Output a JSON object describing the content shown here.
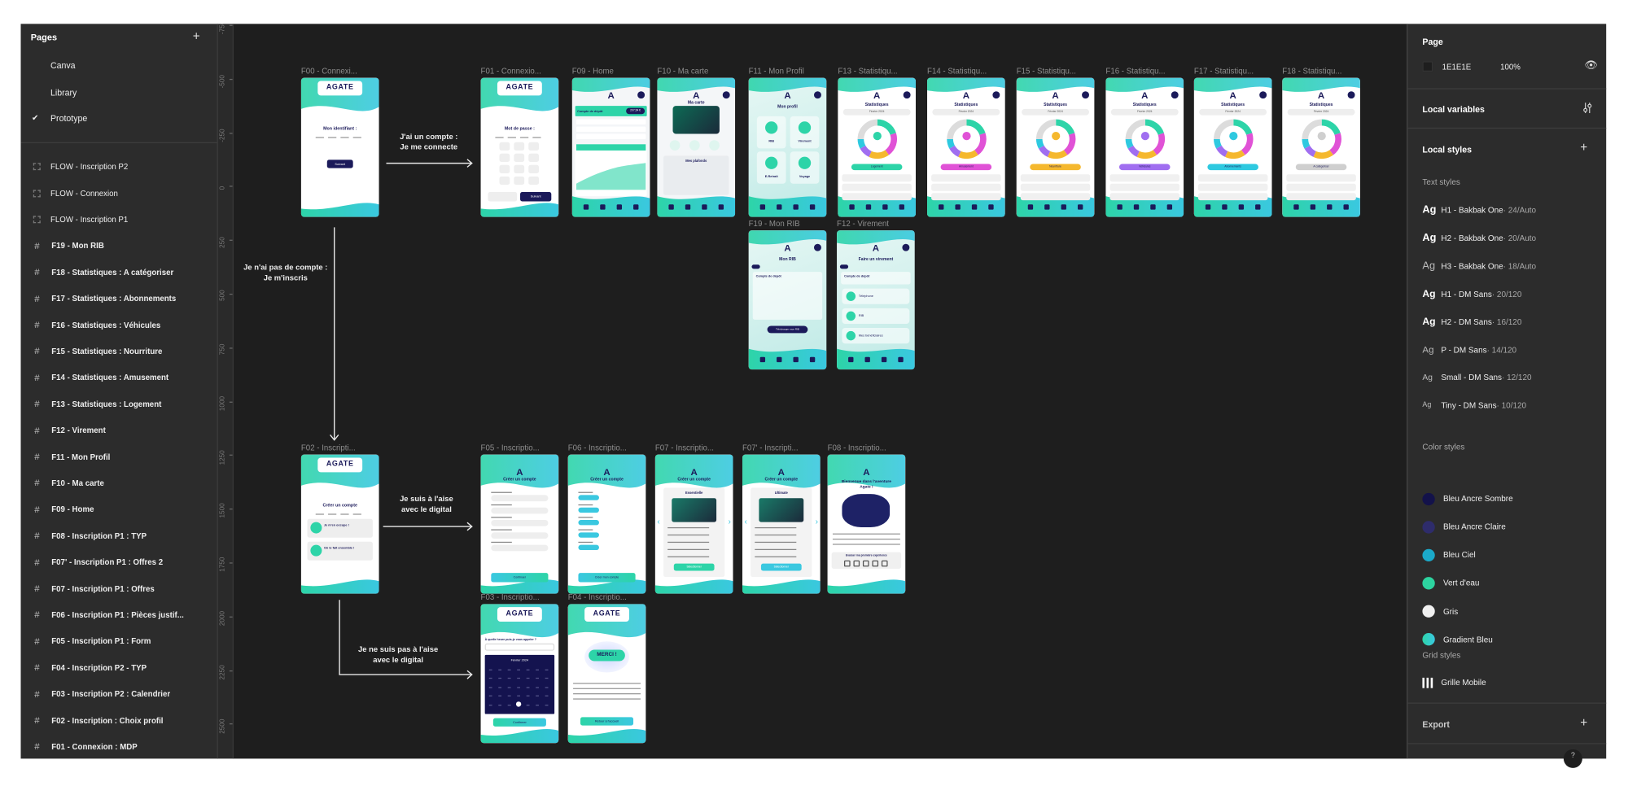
{
  "pages": {
    "title": "Pages",
    "items": [
      {
        "label": "Canva",
        "selected": false
      },
      {
        "label": "Library",
        "selected": false
      },
      {
        "label": "Prototype",
        "selected": true
      }
    ]
  },
  "layers": [
    {
      "type": "section",
      "label": "FLOW - Inscription P2"
    },
    {
      "type": "section",
      "label": "FLOW - Connexion"
    },
    {
      "type": "section",
      "label": "FLOW - Inscription P1"
    },
    {
      "type": "frame",
      "label": "F19 - Mon RIB"
    },
    {
      "type": "frame",
      "label": "F18 - Statistiques : A catégoriser"
    },
    {
      "type": "frame",
      "label": "F17 - Statistiques : Abonnements"
    },
    {
      "type": "frame",
      "label": "F16 - Statistiques : Véhicules"
    },
    {
      "type": "frame",
      "label": "F15 - Statistiques : Nourriture"
    },
    {
      "type": "frame",
      "label": "F14 - Statistiques : Amusement"
    },
    {
      "type": "frame",
      "label": "F13 - Statistiques : Logement"
    },
    {
      "type": "frame",
      "label": "F12 - Virement"
    },
    {
      "type": "frame",
      "label": "F11 - Mon Profil"
    },
    {
      "type": "frame",
      "label": "F10 - Ma carte"
    },
    {
      "type": "frame",
      "label": "F09 - Home"
    },
    {
      "type": "frame",
      "label": "F08 - Inscription P1 : TYP"
    },
    {
      "type": "frame",
      "label": "F07' - Inscription P1 : Offres 2"
    },
    {
      "type": "frame",
      "label": "F07 - Inscription P1 : Offres"
    },
    {
      "type": "frame",
      "label": "F06 - Inscription P1 : Pièces justif..."
    },
    {
      "type": "frame",
      "label": "F05 - Inscription P1 : Form"
    },
    {
      "type": "frame",
      "label": "F04 - Inscription P2 - TYP"
    },
    {
      "type": "frame",
      "label": "F03 - Inscription P2 : Calendrier"
    },
    {
      "type": "frame",
      "label": "F02 - Inscription : Choix profil"
    },
    {
      "type": "frame",
      "label": "F01 - Connexion : MDP"
    }
  ],
  "ruler": [
    "-750",
    "-500",
    "-250",
    "0",
    "250",
    "500",
    "750",
    "1000",
    "1250",
    "1500",
    "1750",
    "2000",
    "2250",
    "2500"
  ],
  "flows": {
    "login": "J'ai un compte :\nJe me connecte",
    "signup": "Je n'ai pas de compte :\nJe m'inscris",
    "digital": "Je suis à l'aise\navec le digital",
    "not_digital": "Je ne suis pas à l'aise\navec le digital"
  },
  "frames": [
    {
      "label": "F00  - Connexi...",
      "kind": "auth",
      "title": "Mon identifiant :",
      "button": "Suivant"
    },
    {
      "label": "F01 - Connexio...",
      "kind": "auth",
      "title": "Mot de passe :",
      "button": "Suivant"
    },
    {
      "label": "F09 - Home",
      "kind": "app",
      "title": "Compte de dépôt",
      "amount": "207,54 €"
    },
    {
      "label": "F10 - Ma carte",
      "kind": "app",
      "title": "Ma carte",
      "sub": "Mes plafonds"
    },
    {
      "label": "F11 - Mon Profil",
      "kind": "profile",
      "title": "Mon profil",
      "tiles": [
        "RIB",
        "Virement",
        "E-Retrait",
        "Voyage"
      ]
    },
    {
      "label": "F13 - Statistiqu...",
      "kind": "stats",
      "title": "Statistiques",
      "month": "Février 2024",
      "category": "Logement",
      "accent": "#2dd4a8"
    },
    {
      "label": "F14 - Statistiqu...",
      "kind": "stats",
      "title": "Statistiques",
      "month": "Février 2024",
      "category": "Amusement",
      "accent": "#e052d6"
    },
    {
      "label": "F15 - Statistiqu...",
      "kind": "stats",
      "title": "Statistiques",
      "month": "Février 2024",
      "category": "Nourriture",
      "accent": "#f5b82e"
    },
    {
      "label": "F16 - Statistiqu...",
      "kind": "stats",
      "title": "Statistiques",
      "month": "Février 2024",
      "category": "Véhicules",
      "accent": "#a06ef0"
    },
    {
      "label": "F17 - Statistiqu...",
      "kind": "stats",
      "title": "Statistiques",
      "month": "Février 2024",
      "category": "Abonnements",
      "accent": "#2ec9e0"
    },
    {
      "label": "F18 - Statistiqu...",
      "kind": "stats",
      "title": "Statistiques",
      "month": "Février 2024",
      "category": "A catégoriser",
      "accent": "#cfcfcf"
    },
    {
      "label": "F19 - Mon RIB",
      "kind": "profile2",
      "title": "Mon RIB",
      "sub": "Compte de dépôt",
      "button": "Télécharger mon RIB"
    },
    {
      "label": "F12 - Virement",
      "kind": "profile2",
      "title": "Faire un virement",
      "sub": "Compte de dépôt",
      "tiles": [
        "Téléphone",
        "RIB",
        "Mes bénéficiaires"
      ]
    },
    {
      "label": "F02 -  Inscripti...",
      "kind": "auth",
      "title": "Créer un compte",
      "cards": [
        "Je m'en occupe !",
        "On le fait ensemble !"
      ]
    },
    {
      "label": "F05 - Inscriptio...",
      "kind": "signup",
      "title": "Créer un compte",
      "button": "Continuer"
    },
    {
      "label": "F06 - Inscriptio...",
      "kind": "signup",
      "title": "Créer un compte",
      "button": "Créer mon compte"
    },
    {
      "label": "F07 - Inscriptio...",
      "kind": "offer",
      "title": "Créer un compte",
      "sub": "Essentielle",
      "button": "Sélectionner"
    },
    {
      "label": "F07' - Inscripti...",
      "kind": "offer",
      "title": "Créer un compte",
      "sub": "Ultimate",
      "button": "Sélectionner"
    },
    {
      "label": "F08 - Inscriptio...",
      "kind": "welcome",
      "title": "Bienvenue dans l'aventure Agate !",
      "sub": "Evaluer ma première expérience"
    },
    {
      "label": "F03 - Inscriptio...",
      "kind": "calendar",
      "title": "À quelle heure puis-je vous appeler ?",
      "sub": "Février 2024",
      "button": "Confirmer"
    },
    {
      "label": "F04 - Inscriptio...",
      "kind": "thanks",
      "title": "MERCI !",
      "button": "Retour à l'accueil"
    }
  ],
  "brand": {
    "logo": "AGATE",
    "navy": "#1b1a5a",
    "teal": "#2dd4a8",
    "cyan": "#3ac8e0"
  },
  "right_panel": {
    "page": {
      "title": "Page",
      "color": "1E1E1E",
      "opacity": "100%"
    },
    "local_variables": "Local variables",
    "local_styles": "Local styles",
    "text_styles_title": "Text styles",
    "text_styles": [
      {
        "name": "H1 - Bakbak One",
        "meta": " · 24/Auto",
        "weight": "bold"
      },
      {
        "name": "H2 - Bakbak One",
        "meta": " · 20/Auto",
        "weight": "bold"
      },
      {
        "name": "H3 - Bakbak One",
        "meta": " · 18/Auto",
        "weight": "normal"
      },
      {
        "name": "H1 - DM Sans",
        "meta": " · 20/120",
        "weight": "bold"
      },
      {
        "name": "H2 - DM Sans",
        "meta": " · 16/120",
        "weight": "bold"
      },
      {
        "name": "P - DM Sans",
        "meta": " · 14/120",
        "weight": "normal"
      },
      {
        "name": "Small - DM Sans",
        "meta": " · 12/120",
        "weight": "normal"
      },
      {
        "name": "Tiny - DM Sans",
        "meta": " · 10/120",
        "weight": "normal"
      }
    ],
    "color_styles_title": "Color styles",
    "color_styles": [
      {
        "name": "Bleu Ancre Sombre",
        "color": "#13124a"
      },
      {
        "name": "Bleu Ancre Claire",
        "color": "#2e2c6b"
      },
      {
        "name": "Bleu Ciel",
        "color": "#1ba9c9"
      },
      {
        "name": "Vert d'eau",
        "color": "#2dd4a0"
      },
      {
        "name": "Gris",
        "color": "#f0f0f0"
      },
      {
        "name": "Gradient Bleu",
        "color": "linear-gradient(90deg,#2dd4a8,#3ac8e0)"
      }
    ],
    "grid_styles_title": "Grid styles",
    "grid_styles": [
      "Grille Mobile"
    ],
    "export": "Export"
  }
}
